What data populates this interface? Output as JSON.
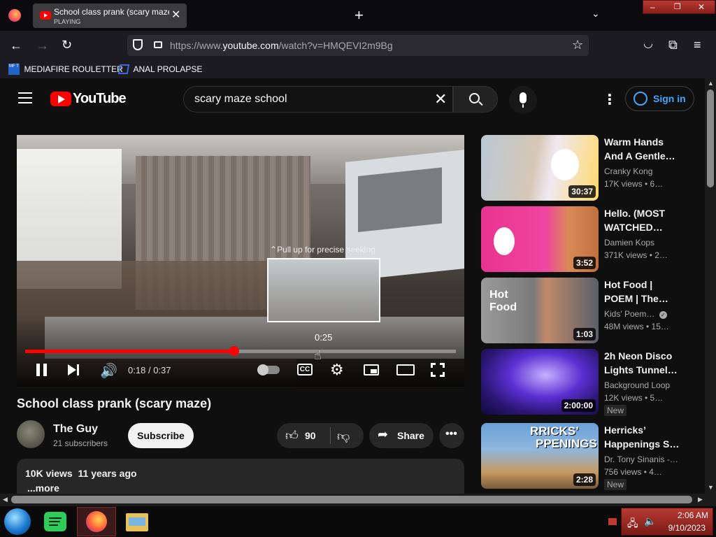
{
  "browser": {
    "tab_title": "School class prank (scary maze",
    "tab_status": "PLAYING",
    "new_tab": "+",
    "url_host": "https://www.",
    "url_domain": "youtube.com",
    "url_path": "/watch?v=HMQEVI2m9Bg",
    "bookmarks": [
      {
        "icon_text": "MF T",
        "label": "MEDIAFIRE ROULETTER"
      },
      {
        "label": "ANAL PROLAPSE"
      }
    ]
  },
  "youtube": {
    "logo_text": "YouTube",
    "search_value": "scary maze school",
    "sign_in": "Sign in"
  },
  "player": {
    "seek_hint": "Pull up for precise seeking",
    "preview_time": "0:25",
    "time_current": "0:18",
    "time_sep": "/",
    "time_total": "0:37",
    "cc_label": "CC",
    "progress": 0.486,
    "hover_position": 0.68
  },
  "video": {
    "title": "School class prank (scary maze)",
    "channel": "The Guy",
    "subscribers": "21 subscribers",
    "subscribe_label": "Subscribe",
    "likes": "90",
    "share_label": "Share",
    "views": "10K views",
    "age": "11 years ago",
    "more_label": "...more"
  },
  "related": [
    {
      "title1": "Warm Hands",
      "title2": "And A Gentle…",
      "channel": "Cranky Kong",
      "meta": "17K views • 6…",
      "duration": "30:37",
      "verified": false,
      "new": false
    },
    {
      "title1": "Hello. (MOST",
      "title2": "WATCHED…",
      "channel": "Damien Kops",
      "meta": "371K views • 2…",
      "duration": "3:52",
      "verified": false,
      "new": false
    },
    {
      "title1": "Hot Food |",
      "title2": "POEM | The…",
      "channel": "Kids' Poem…",
      "meta": "48M views • 15…",
      "duration": "1:03",
      "verified": true,
      "new": false,
      "thumb_text1": "Hot",
      "thumb_text2": "Food"
    },
    {
      "title1": "2h Neon Disco",
      "title2": "Lights Tunnel…",
      "channel": "Background Loop",
      "meta": "12K views • 5…",
      "duration": "2:00:00",
      "verified": false,
      "new": true,
      "new_label": "New"
    },
    {
      "title1": "Herricks’",
      "title2": "Happenings S…",
      "channel": "Dr. Tony Sinanis -…",
      "meta": "756 views • 4…",
      "duration": "2:28",
      "verified": false,
      "new": true,
      "new_label": "New",
      "thumb_text1": "RRICKS’",
      "thumb_text2": "PPENINGS"
    }
  ],
  "taskbar": {
    "time": "2:06 AM",
    "date": "9/10/2023"
  },
  "colors": {
    "yt_red": "#ff0000",
    "progress_red": "#f00",
    "sign_in_blue": "#3ea6ff",
    "page_bg": "#0f0f0f"
  }
}
